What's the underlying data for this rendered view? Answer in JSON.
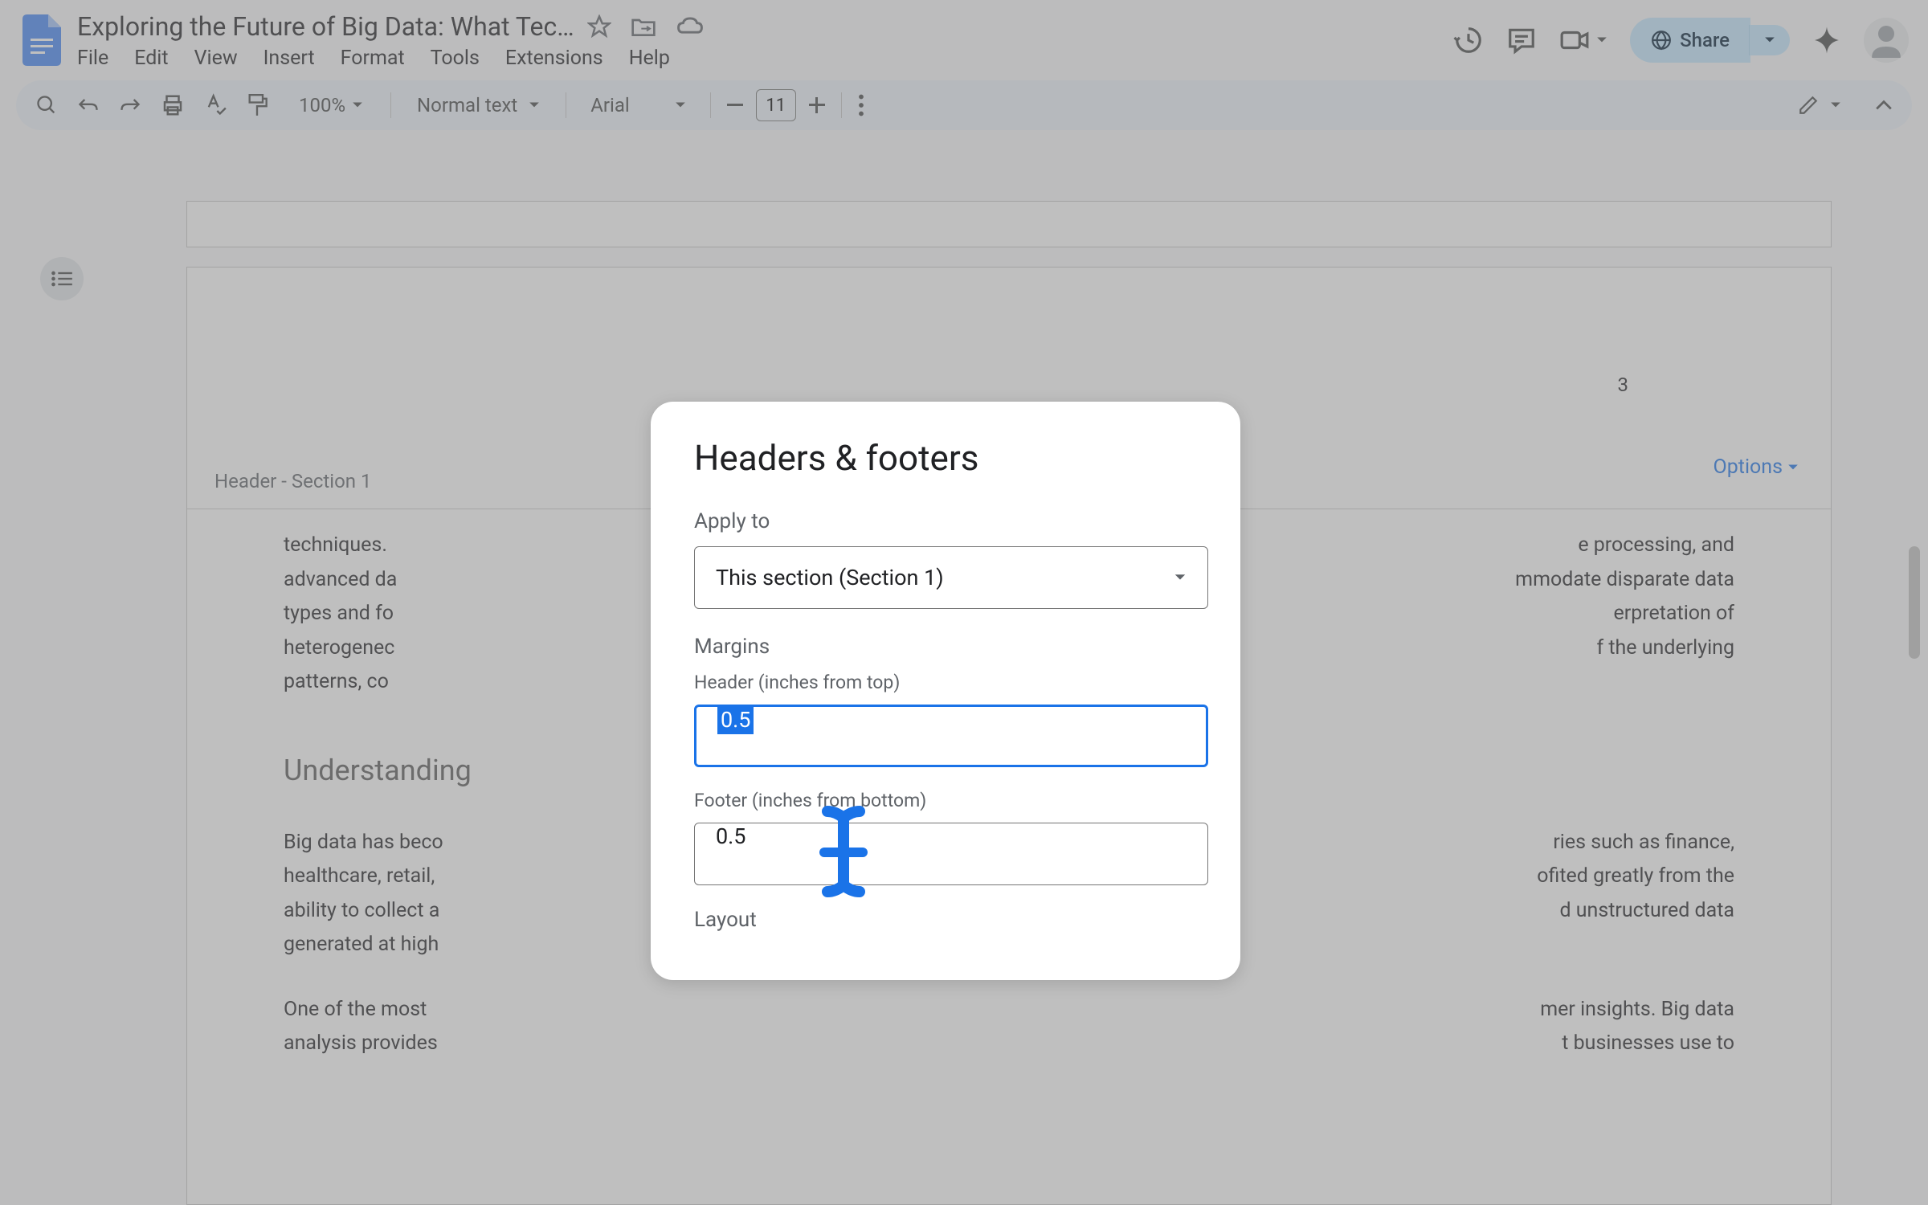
{
  "header": {
    "doc_title": "Exploring the Future of Big Data: What Tec…",
    "menu": {
      "file": "File",
      "edit": "Edit",
      "view": "View",
      "insert": "Insert",
      "format": "Format",
      "tools": "Tools",
      "extensions": "Extensions",
      "help": "Help"
    },
    "share_label": "Share"
  },
  "toolbar": {
    "zoom": "100%",
    "style": "Normal text",
    "font": "Arial",
    "font_size": "11"
  },
  "document": {
    "page_number": "3",
    "header_label": "Header - Section 1",
    "options_label": "Options",
    "para1_a": "techniques.",
    "para1_b": "e processing, and",
    "para2_a": "advanced da",
    "para2_b": "mmodate disparate data",
    "para3_a": "types and fo",
    "para3_b": "erpretation of",
    "para4_a": "heterogenec",
    "para4_b": "f the underlying",
    "para5_a": "patterns, co",
    "heading": "Understanding",
    "body1_a": "Big data has beco",
    "body1_b": "ries such as finance,",
    "body2_a": "healthcare, retail,",
    "body2_b": "ofited greatly from the",
    "body3_a": "ability to collect a",
    "body3_b": "d unstructured data",
    "body4_a": "generated at high",
    "body5_a": "One of the most ",
    "body5_b": "mer insights. Big data",
    "body6_a": "analysis provides",
    "body6_b": "t businesses use to"
  },
  "dialog": {
    "title": "Headers & footers",
    "apply_to_label": "Apply to",
    "apply_to_value": "This section (Section 1)",
    "margins_label": "Margins",
    "header_margin_label": "Header (inches from top)",
    "header_margin_value": "0.5",
    "footer_margin_label": "Footer (inches from bottom)",
    "footer_margin_value": "0.5",
    "layout_label": "Layout"
  }
}
